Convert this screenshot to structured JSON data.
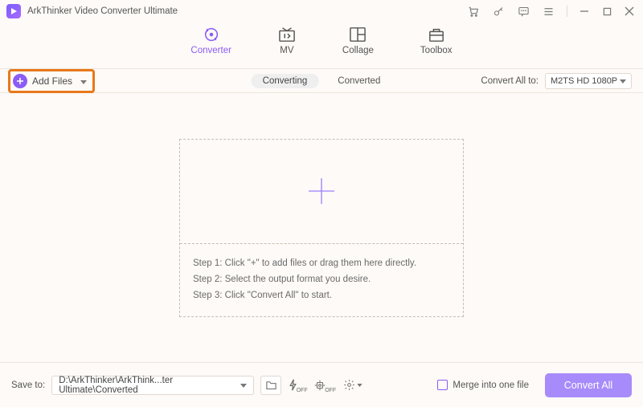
{
  "app": {
    "title": "ArkThinker Video Converter Ultimate"
  },
  "tabs": {
    "converter": "Converter",
    "mv": "MV",
    "collage": "Collage",
    "toolbox": "Toolbox"
  },
  "toolbar": {
    "add_files": "Add Files",
    "converting": "Converting",
    "converted": "Converted",
    "convert_all_to_label": "Convert All to:",
    "format_value": "M2TS HD 1080P"
  },
  "drop": {
    "step1": "Step 1: Click \"+\" to add files or drag them here directly.",
    "step2": "Step 2: Select the output format you desire.",
    "step3": "Step 3: Click \"Convert All\" to start."
  },
  "footer": {
    "save_to_label": "Save to:",
    "save_path": "D:\\ArkThinker\\ArkThink...ter Ultimate\\Converted",
    "merge_label": "Merge into one file",
    "convert_all": "Convert All"
  }
}
